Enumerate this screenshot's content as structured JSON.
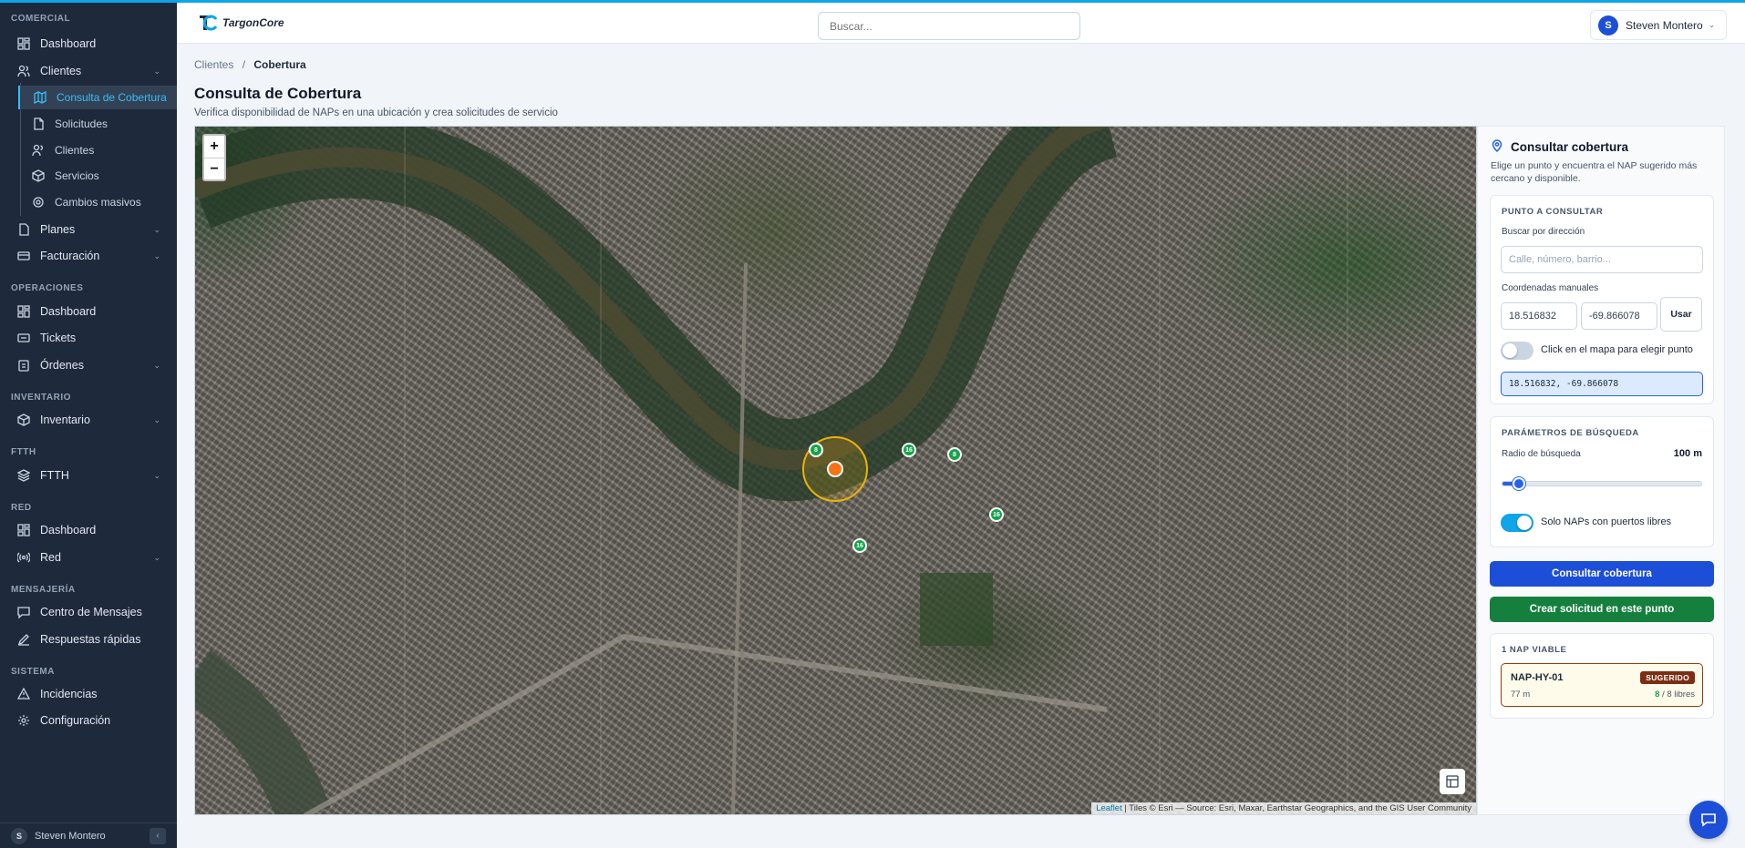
{
  "app": {
    "logo_text": "TargonCore"
  },
  "sidebar": {
    "sections": {
      "comercial": "COMERCIAL",
      "operaciones": "OPERACIONES",
      "inventario": "INVENTARIO",
      "ftth": "FTTH",
      "red": "RED",
      "mensajeria": "MENSAJERÍA",
      "sistema": "SISTEMA"
    },
    "items": {
      "dashboard_comercial": "Dashboard",
      "clientes": "Clientes",
      "consulta_cobertura": "Consulta de Cobertura",
      "solicitudes": "Solicitudes",
      "clientes_sub": "Clientes",
      "servicios": "Servicios",
      "cambios_masivos": "Cambios masivos",
      "planes": "Planes",
      "facturacion": "Facturación",
      "dashboard_operaciones": "Dashboard",
      "tickets": "Tickets",
      "ordenes": "Órdenes",
      "inventario": "Inventario",
      "ftth": "FTTH",
      "dashboard_red": "Dashboard",
      "red": "Red",
      "centro_mensajes": "Centro de Mensajes",
      "respuestas_rapidas": "Respuestas rápidas",
      "incidencias": "Incidencias",
      "configuracion": "Configuración"
    },
    "footer": {
      "avatar_initial": "S",
      "user_name": "Steven Montero"
    }
  },
  "header": {
    "search_placeholder": "Buscar...",
    "user": {
      "initial": "S",
      "name": "Steven Montero"
    }
  },
  "breadcrumb": {
    "parent": "Clientes",
    "separator": "/",
    "current": "Cobertura"
  },
  "page": {
    "title": "Consulta de Cobertura",
    "subtitle": "Verifica disponibilidad de NAPs en una ubicación y crea solicitudes de servicio"
  },
  "map": {
    "zoom_in": "+",
    "zoom_out": "−",
    "markers": [
      "8",
      "16",
      "8",
      "16",
      "16"
    ],
    "attribution_link": "Leaflet",
    "attribution_text": " | Tiles © Esri — Source: Esri, Maxar, Earthstar Geographics, and the GIS User Community"
  },
  "panel": {
    "title": "Consultar cobertura",
    "description": "Elige un punto y encuentra el NAP sugerido más cercano y disponible.",
    "point_card": {
      "heading": "PUNTO A CONSULTAR",
      "address_label": "Buscar por dirección",
      "address_placeholder": "Calle, número, barrio...",
      "coords_label": "Coordenadas manuales",
      "lat": "18.516832",
      "lng": "-69.866078",
      "use_button": "Usar",
      "map_click_label": "Click en el mapa para elegir punto",
      "map_click_enabled": false,
      "coords_output": "18.516832, -69.866078"
    },
    "params_card": {
      "heading": "PARÁMETROS DE BÚSQUEDA",
      "radius_label": "Radio de búsqueda",
      "radius_value": "100 m",
      "radius_fraction": 0.05,
      "free_ports_label": "Solo NAPs con puertos libres",
      "free_ports_enabled": true
    },
    "consult_button": "Consultar cobertura",
    "create_button": "Crear solicitud en este punto",
    "results": {
      "heading": "1 NAP VIABLE",
      "nap": {
        "name": "NAP-HY-01",
        "badge": "SUGERIDO",
        "distance": "77 m",
        "free_ports": "8",
        "ports_total": " / 8 libres"
      }
    }
  },
  "colors": {
    "sidebar_bg": "#1e293b",
    "accent": "#38bdf8",
    "primary": "#1d4ed8",
    "success": "#15803d"
  }
}
